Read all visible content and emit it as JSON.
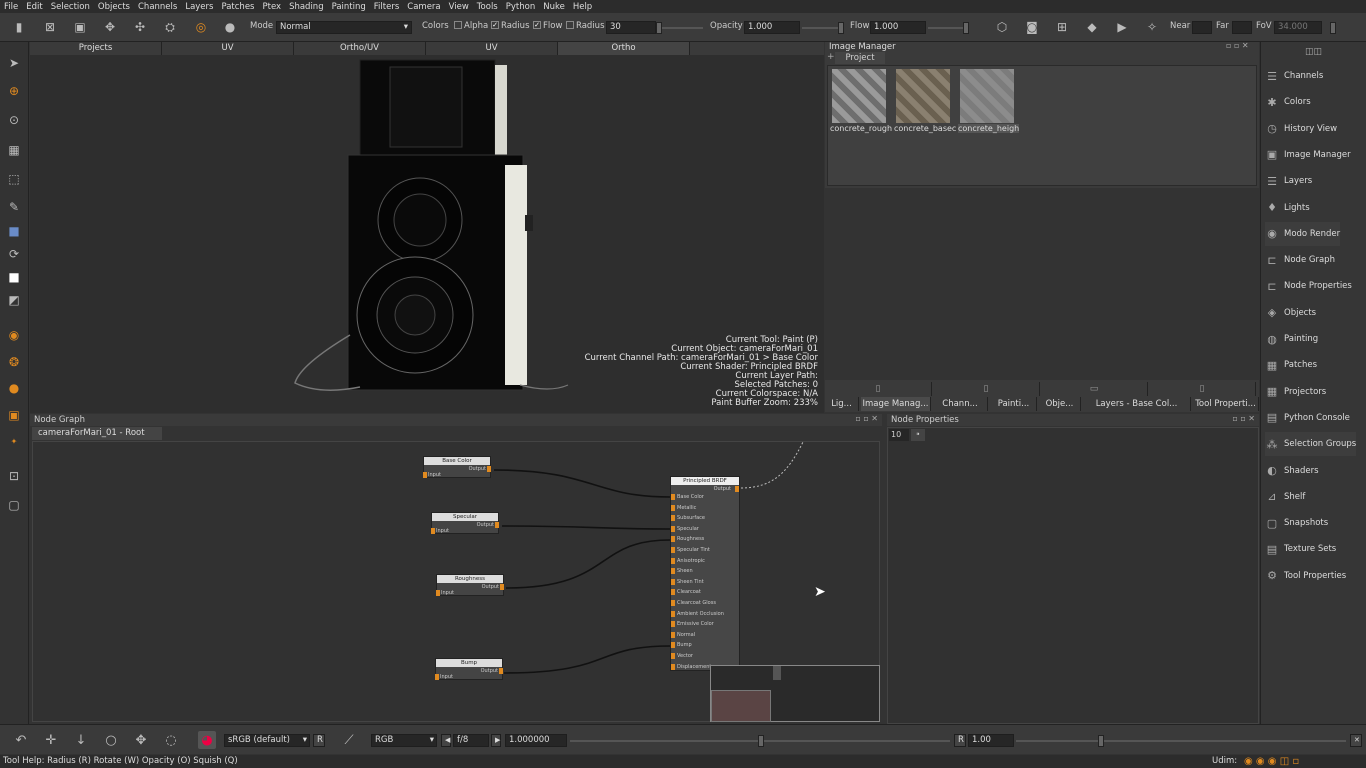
{
  "menu": [
    "File",
    "Edit",
    "Selection",
    "Objects",
    "Channels",
    "Layers",
    "Patches",
    "Ptex",
    "Shading",
    "Painting",
    "Filters",
    "Camera",
    "View",
    "Tools",
    "Python",
    "Nuke",
    "Help"
  ],
  "toolbar": {
    "mode_label": "Mode",
    "mode_value": "Normal",
    "colors_label": "Colors",
    "alpha_label": "Alpha",
    "radius_label": "Radius",
    "flow_label": "Flow",
    "radius2_label": "Radius",
    "radius_value": "30",
    "opacity_label": "Opacity",
    "opacity_value": "1.000",
    "flow2_label": "Flow",
    "flow_value": "1.000",
    "near_label": "Near",
    "far_label": "Far",
    "fov_label": "FoV",
    "fov_value": "34.000"
  },
  "viewport_tabs": [
    "Projects",
    "UV",
    "Ortho/UV",
    "UV",
    "Ortho"
  ],
  "viewport_info": [
    "Current Tool: Paint (P)",
    "Current Object: cameraForMari_01",
    "Current Channel Path: cameraForMari_01 > Base Color",
    "Current Shader: Principled BRDF",
    "Current Layer Path:",
    "Selected Patches: 0",
    "Current Colorspace: N/A",
    "Paint Buffer Zoom: 233%"
  ],
  "image_manager": {
    "title": "Image Manager",
    "tab": "Project",
    "images": [
      "concrete_rough",
      "concrete_basec",
      "concrete_heigh"
    ]
  },
  "dock_tabs": [
    "Lig...",
    "Image Manag...",
    "Chann...",
    "Painti...",
    "Obje...",
    "Layers - Base Col...",
    "Tool Properti..."
  ],
  "right_shelf": [
    "Channels",
    "Colors",
    "History View",
    "Image Manager",
    "Layers",
    "Lights",
    "Modo Render",
    "Node Graph",
    "Node Properties",
    "Objects",
    "Painting",
    "Patches",
    "Projectors",
    "Python Console",
    "Selection Groups",
    "Shaders",
    "Shelf",
    "Snapshots",
    "Texture Sets",
    "Tool Properties"
  ],
  "node_graph": {
    "title": "Node Graph",
    "tab": "cameraForMari_01 - Root",
    "nodes": [
      {
        "title": "Base Color",
        "out": "Output",
        "in": "Input"
      },
      {
        "title": "Specular",
        "out": "Output",
        "in": "Input"
      },
      {
        "title": "Roughness",
        "out": "Output",
        "in": "Input"
      },
      {
        "title": "Bump",
        "out": "Output",
        "in": "Input"
      }
    ],
    "brdf": {
      "title": "Principled BRDF",
      "out": "Output",
      "inputs": [
        "Base Color",
        "Metallic",
        "Subsurface",
        "Specular",
        "Roughness",
        "Specular Tint",
        "Anisotropic",
        "Sheen",
        "Sheen Tint",
        "Clearcoat",
        "Clearcoat Gloss",
        "Ambient Occlusion",
        "Emissive Color",
        "Normal",
        "Bump",
        "Vector",
        "Displacement"
      ]
    }
  },
  "node_properties": {
    "title": "Node Properties",
    "value": "10"
  },
  "bottom": {
    "colorspace": "sRGB (default)",
    "channel": "RGB",
    "fstop": "f/8",
    "exposure": "1.000000",
    "r_label": "R",
    "gamma": "1.00"
  },
  "status": {
    "text": "Tool Help:   Radius (R)   Rotate (W)   Opacity (O)   Squish (Q)",
    "udim": "Udim:"
  },
  "colors": {
    "accent": "#e08a20",
    "panel": "#3a3a3a",
    "viewport": "#2e2e2e"
  }
}
